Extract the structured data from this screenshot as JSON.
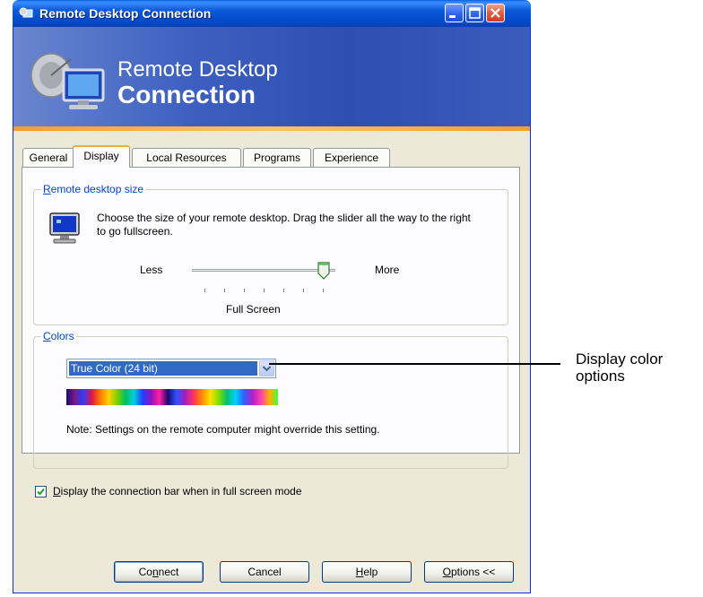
{
  "window": {
    "title": "Remote Desktop Connection",
    "banner_line1": "Remote Desktop",
    "banner_line2": "Connection"
  },
  "tabs": [
    {
      "label": "General"
    },
    {
      "label": "Display"
    },
    {
      "label": "Local Resources"
    },
    {
      "label": "Programs"
    },
    {
      "label": "Experience"
    }
  ],
  "active_tab": "Display",
  "remote_size": {
    "legend_prefix": "R",
    "legend_rest": "emote desktop size",
    "description": "Choose the size of your remote desktop. Drag the slider all the way to the right to go fullscreen.",
    "less_label": "Less",
    "more_label": "More",
    "value_label": "Full Screen",
    "slider_fraction": 1.0
  },
  "colors": {
    "legend_prefix": "C",
    "legend_rest": "olors",
    "selected": "True Color (24 bit)",
    "note": "Note: Settings on the remote computer might override this setting."
  },
  "connection_bar": {
    "checked": true,
    "label_prefix": "D",
    "label_rest": "isplay the connection bar when in full screen mode"
  },
  "buttons": {
    "connect_pre": "Co",
    "connect_u": "n",
    "connect_post": "nect",
    "cancel": "Cancel",
    "help_u": "H",
    "help_post": "elp",
    "options_u": "O",
    "options_post": "ptions <<"
  },
  "callout": {
    "line1": "Display color",
    "line2": "options"
  },
  "colors_theme": {
    "titlebar": "#0a58d8",
    "window_bg": "#ece9d8",
    "selection": "#316ac5"
  }
}
